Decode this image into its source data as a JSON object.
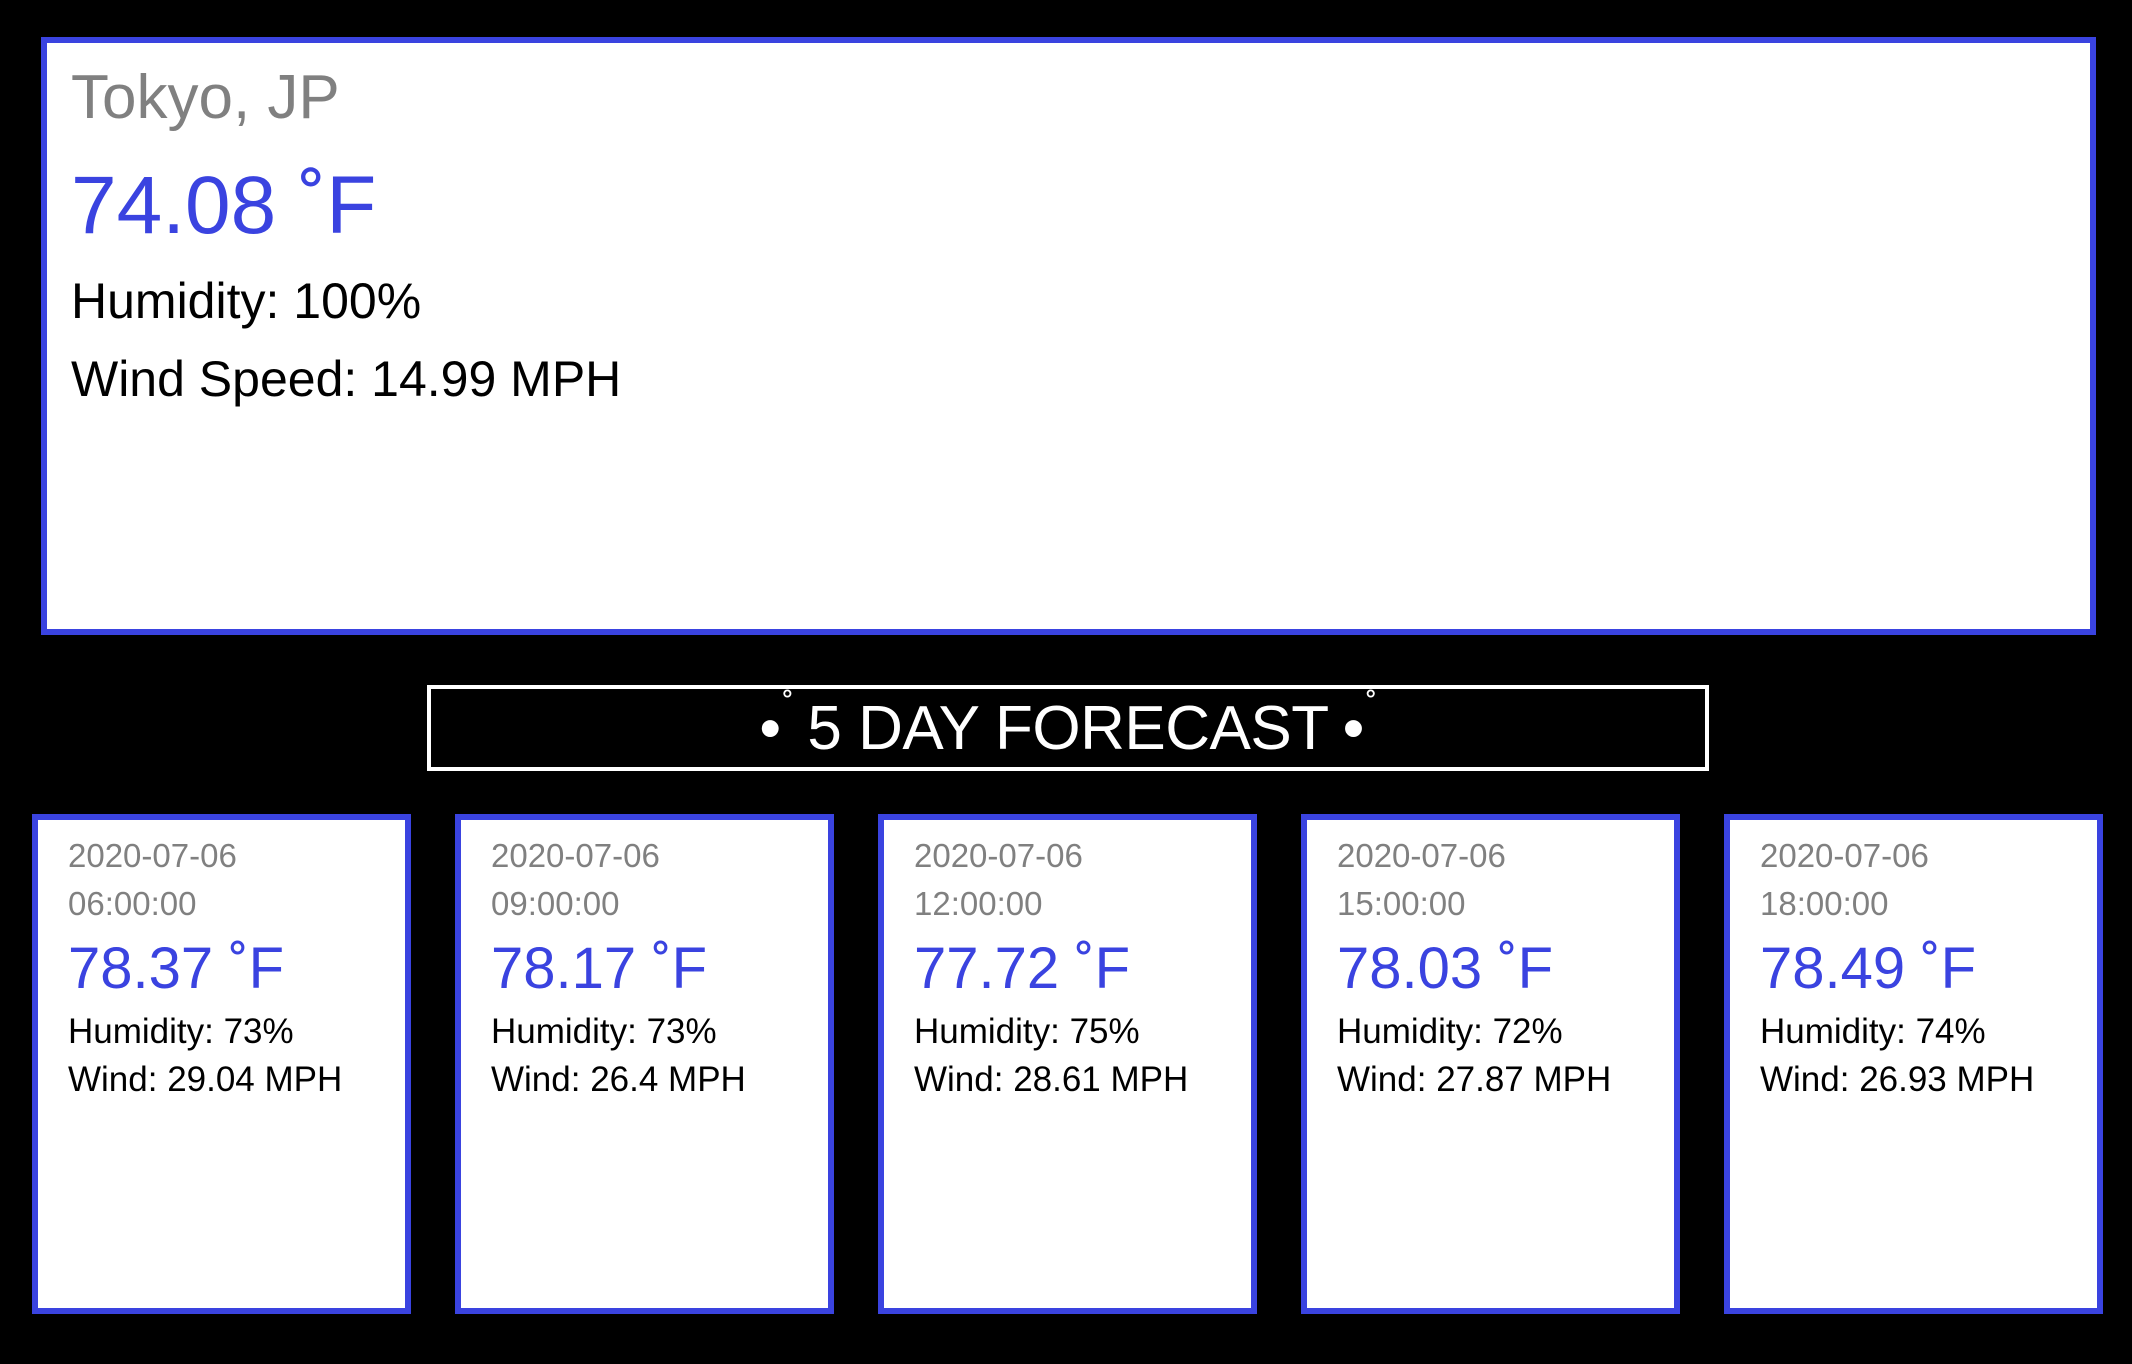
{
  "current": {
    "city": "Tokyo, JP",
    "temperature": "74.08 ˚F",
    "humidity": "Humidity: 100%",
    "wind": "Wind Speed: 14.99 MPH"
  },
  "forecast_title": {
    "label": "5 DAY FORECAST",
    "bullet": "•",
    "degree": "˚"
  },
  "forecast": [
    {
      "date": "2020-07-06",
      "time": "06:00:00",
      "temperature": "78.37 ˚F",
      "humidity": "Humidity: 73%",
      "wind": "Wind: 29.04 MPH"
    },
    {
      "date": "2020-07-06",
      "time": "09:00:00",
      "temperature": "78.17 ˚F",
      "humidity": "Humidity: 73%",
      "wind": "Wind: 26.4 MPH"
    },
    {
      "date": "2020-07-06",
      "time": "12:00:00",
      "temperature": "77.72 ˚F",
      "humidity": "Humidity: 75%",
      "wind": "Wind: 28.61 MPH"
    },
    {
      "date": "2020-07-06",
      "time": "15:00:00",
      "temperature": "78.03 ˚F",
      "humidity": "Humidity: 72%",
      "wind": "Wind: 27.87 MPH"
    },
    {
      "date": "2020-07-06",
      "time": "18:00:00",
      "temperature": "78.49 ˚F",
      "humidity": "Humidity: 74%",
      "wind": "Wind: 26.93 MPH"
    }
  ],
  "colors": {
    "accent": "#3a43e0",
    "background": "#000000",
    "card": "#ffffff",
    "muted_text": "#808080"
  }
}
